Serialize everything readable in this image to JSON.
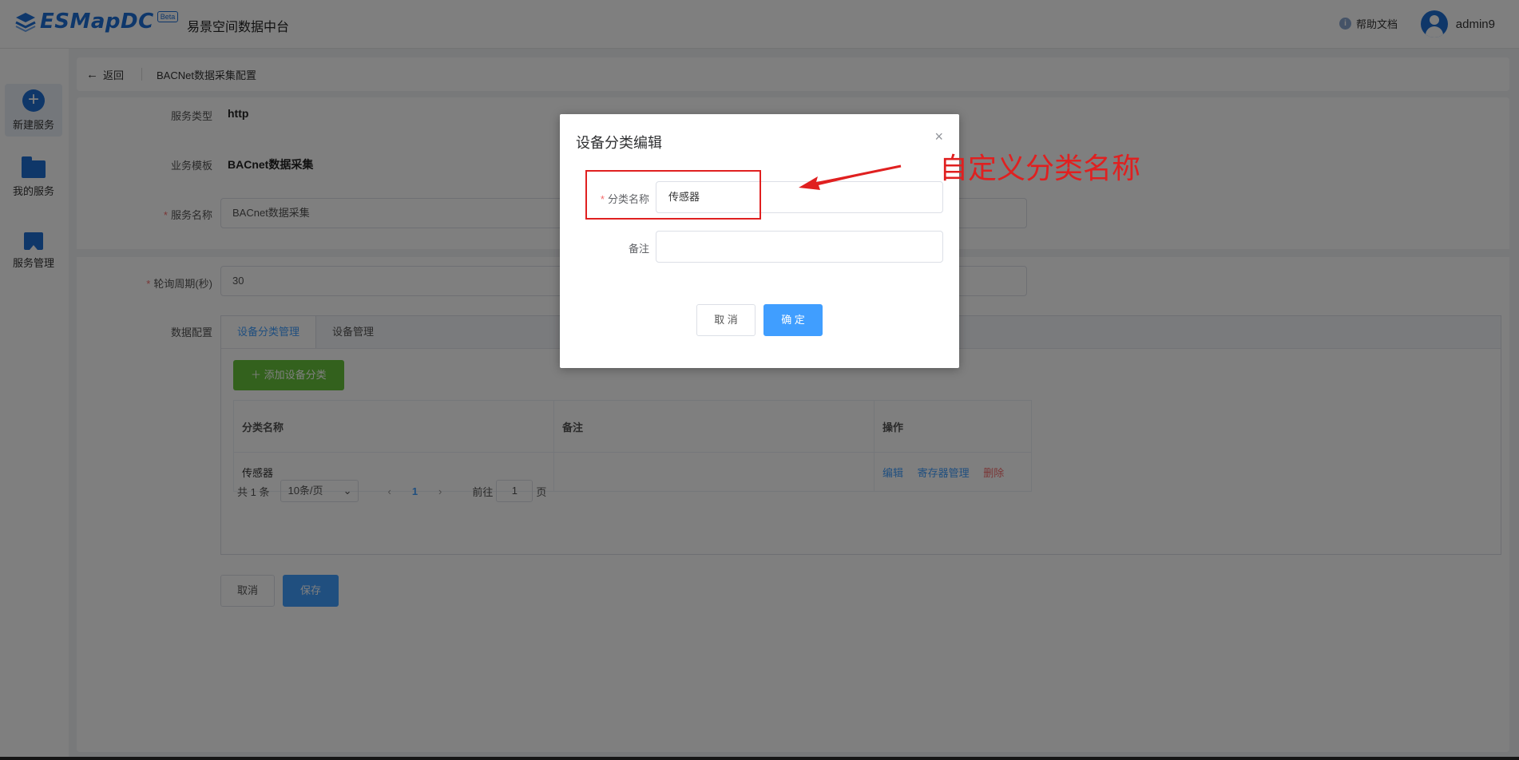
{
  "header": {
    "logo_text": "ESMapDC",
    "logo_badge": "Beta",
    "app_title": "易景空间数据中台",
    "help_label": "帮助文档",
    "username": "admin9"
  },
  "sidebar": {
    "items": [
      {
        "label": "新建服务",
        "icon": "plus-circle-icon"
      },
      {
        "label": "我的服务",
        "icon": "folder-icon"
      },
      {
        "label": "服务管理",
        "icon": "bookmark-icon"
      }
    ]
  },
  "breadcrumb": {
    "back_label": "返回",
    "page_title": "BACNet数据采集配置"
  },
  "form": {
    "service_type_label": "服务类型",
    "service_type_value": "http",
    "template_label": "业务模板",
    "template_value": "BACnet数据采集",
    "service_name_label": "服务名称",
    "service_name_value": "BACnet数据采集",
    "poll_label": "轮询周期(秒)",
    "poll_value": "30",
    "data_config_label": "数据配置"
  },
  "tabs": [
    {
      "label": "设备分类管理",
      "active": true
    },
    {
      "label": "设备管理",
      "active": false
    }
  ],
  "category": {
    "add_button": "添加设备分类",
    "columns": [
      "分类名称",
      "备注",
      "操作"
    ],
    "rows": [
      {
        "name": "传感器",
        "remark": "",
        "actions": [
          "编辑",
          "寄存器管理",
          "删除"
        ]
      }
    ]
  },
  "pagination": {
    "total_text": "共 1 条",
    "page_size": "10条/页",
    "current_page": "1",
    "goto_label": "前往",
    "goto_value": "1",
    "page_suffix": "页"
  },
  "footer_buttons": {
    "cancel": "取消",
    "save": "保存"
  },
  "dialog": {
    "title": "设备分类编辑",
    "close": "×",
    "name_label": "分类名称",
    "name_value": "传感器",
    "remark_label": "备注",
    "remark_value": "",
    "cancel": "取 消",
    "confirm": "确 定"
  },
  "annotation": {
    "text": "自定义分类名称",
    "color": "#e02020"
  },
  "colors": {
    "primary": "#409eff",
    "brand": "#1f6fd2",
    "success": "#67c23a",
    "danger": "#f56c6c"
  }
}
